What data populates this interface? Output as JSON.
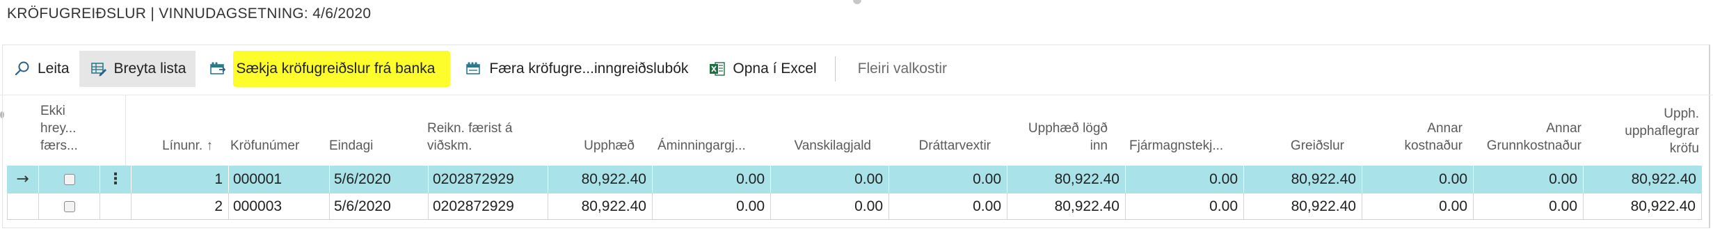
{
  "page": {
    "title": "KRÖFUGREIÐSLUR | VINNUDAGSETNING: 4/6/2020"
  },
  "colors": {
    "selected_row": "#a9e2e8",
    "highlight": "#fdfd2b",
    "excel_green": "#1d6f42",
    "icon_teal": "#2b7a8b"
  },
  "toolbar": {
    "search_label": "Leita",
    "search_icon": "search-icon",
    "edit_list_label": "Breyta lista",
    "edit_list_icon": "edit-list-icon",
    "fetch_label": "Sækja kröfugreiðslur frá banka",
    "fetch_icon": "bank-import-icon",
    "post_label": "Færa kröfugre...inngreiðslubók",
    "post_icon": "journal-icon",
    "excel_label": "Opna í Excel",
    "excel_icon": "excel-icon",
    "more_label": "Fleiri valkostir"
  },
  "table": {
    "headers": {
      "not_modified": [
        "Ekki",
        "hrey...",
        "færs..."
      ],
      "line_no": "Línunr. ↑",
      "claim_no": "Kröfunúmer",
      "due_date": "Eindagi",
      "account": [
        "Reikn. færist á",
        "viðskm."
      ],
      "amount": "Upphæð",
      "reminder_fee": "Áminningargj...",
      "default_fee": "Vanskilagjald",
      "penalty_interest": "Dráttarvextir",
      "deposited_amount": [
        "Upphæð lögð",
        "inn"
      ],
      "capital_income": "Fjármagnstekj...",
      "payments": "Greiðslur",
      "other_cost": [
        "Annar",
        "kostnaður"
      ],
      "other_base_cost": [
        "Annar",
        "Grunnkostnaður"
      ],
      "original_claim_amount": [
        "Upph.",
        "upphaflegrar",
        "kröfu"
      ]
    },
    "rows": [
      {
        "line_no": "1",
        "claim_no": "000001",
        "due_date": "5/6/2020",
        "account": "0202872929",
        "amount": "80,922.40",
        "reminder_fee": "0.00",
        "default_fee": "0.00",
        "penalty_interest": "0.00",
        "deposited_amount": "80,922.40",
        "capital_income": "0.00",
        "payments": "80,922.40",
        "other_cost": "0.00",
        "other_base_cost": "0.00",
        "original_claim_amount": "80,922.40"
      },
      {
        "line_no": "2",
        "claim_no": "000003",
        "due_date": "5/6/2020",
        "account": "0202872929",
        "amount": "80,922.40",
        "reminder_fee": "0.00",
        "default_fee": "0.00",
        "penalty_interest": "0.00",
        "deposited_amount": "80,922.40",
        "capital_income": "0.00",
        "payments": "80,922.40",
        "other_cost": "0.00",
        "other_base_cost": "0.00",
        "original_claim_amount": "80,922.40"
      }
    ]
  }
}
